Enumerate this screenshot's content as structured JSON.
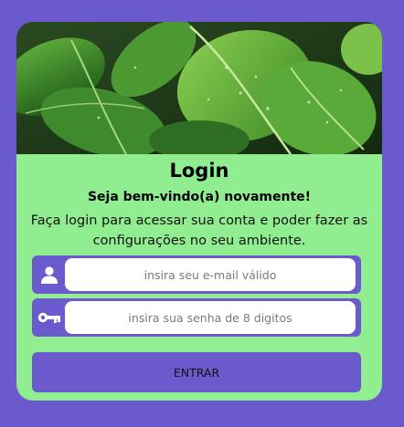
{
  "login": {
    "title": "Login",
    "subtitle": "Seja bem-vindo(a) novamente!",
    "description": "Faça login para acessar sua conta e poder fazer as configurações no seu ambiente.",
    "email": {
      "icon": "user-icon",
      "value": "",
      "placeholder": "insira seu e-mail válido"
    },
    "password": {
      "icon": "key-icon",
      "value": "",
      "placeholder": "insira sua senha de 8 digitos"
    },
    "submit_label": "ENTRAR"
  },
  "colors": {
    "background": "#6a5acd",
    "card": "#90ee90",
    "accent": "#6a5acd",
    "input": "#ffffff"
  }
}
